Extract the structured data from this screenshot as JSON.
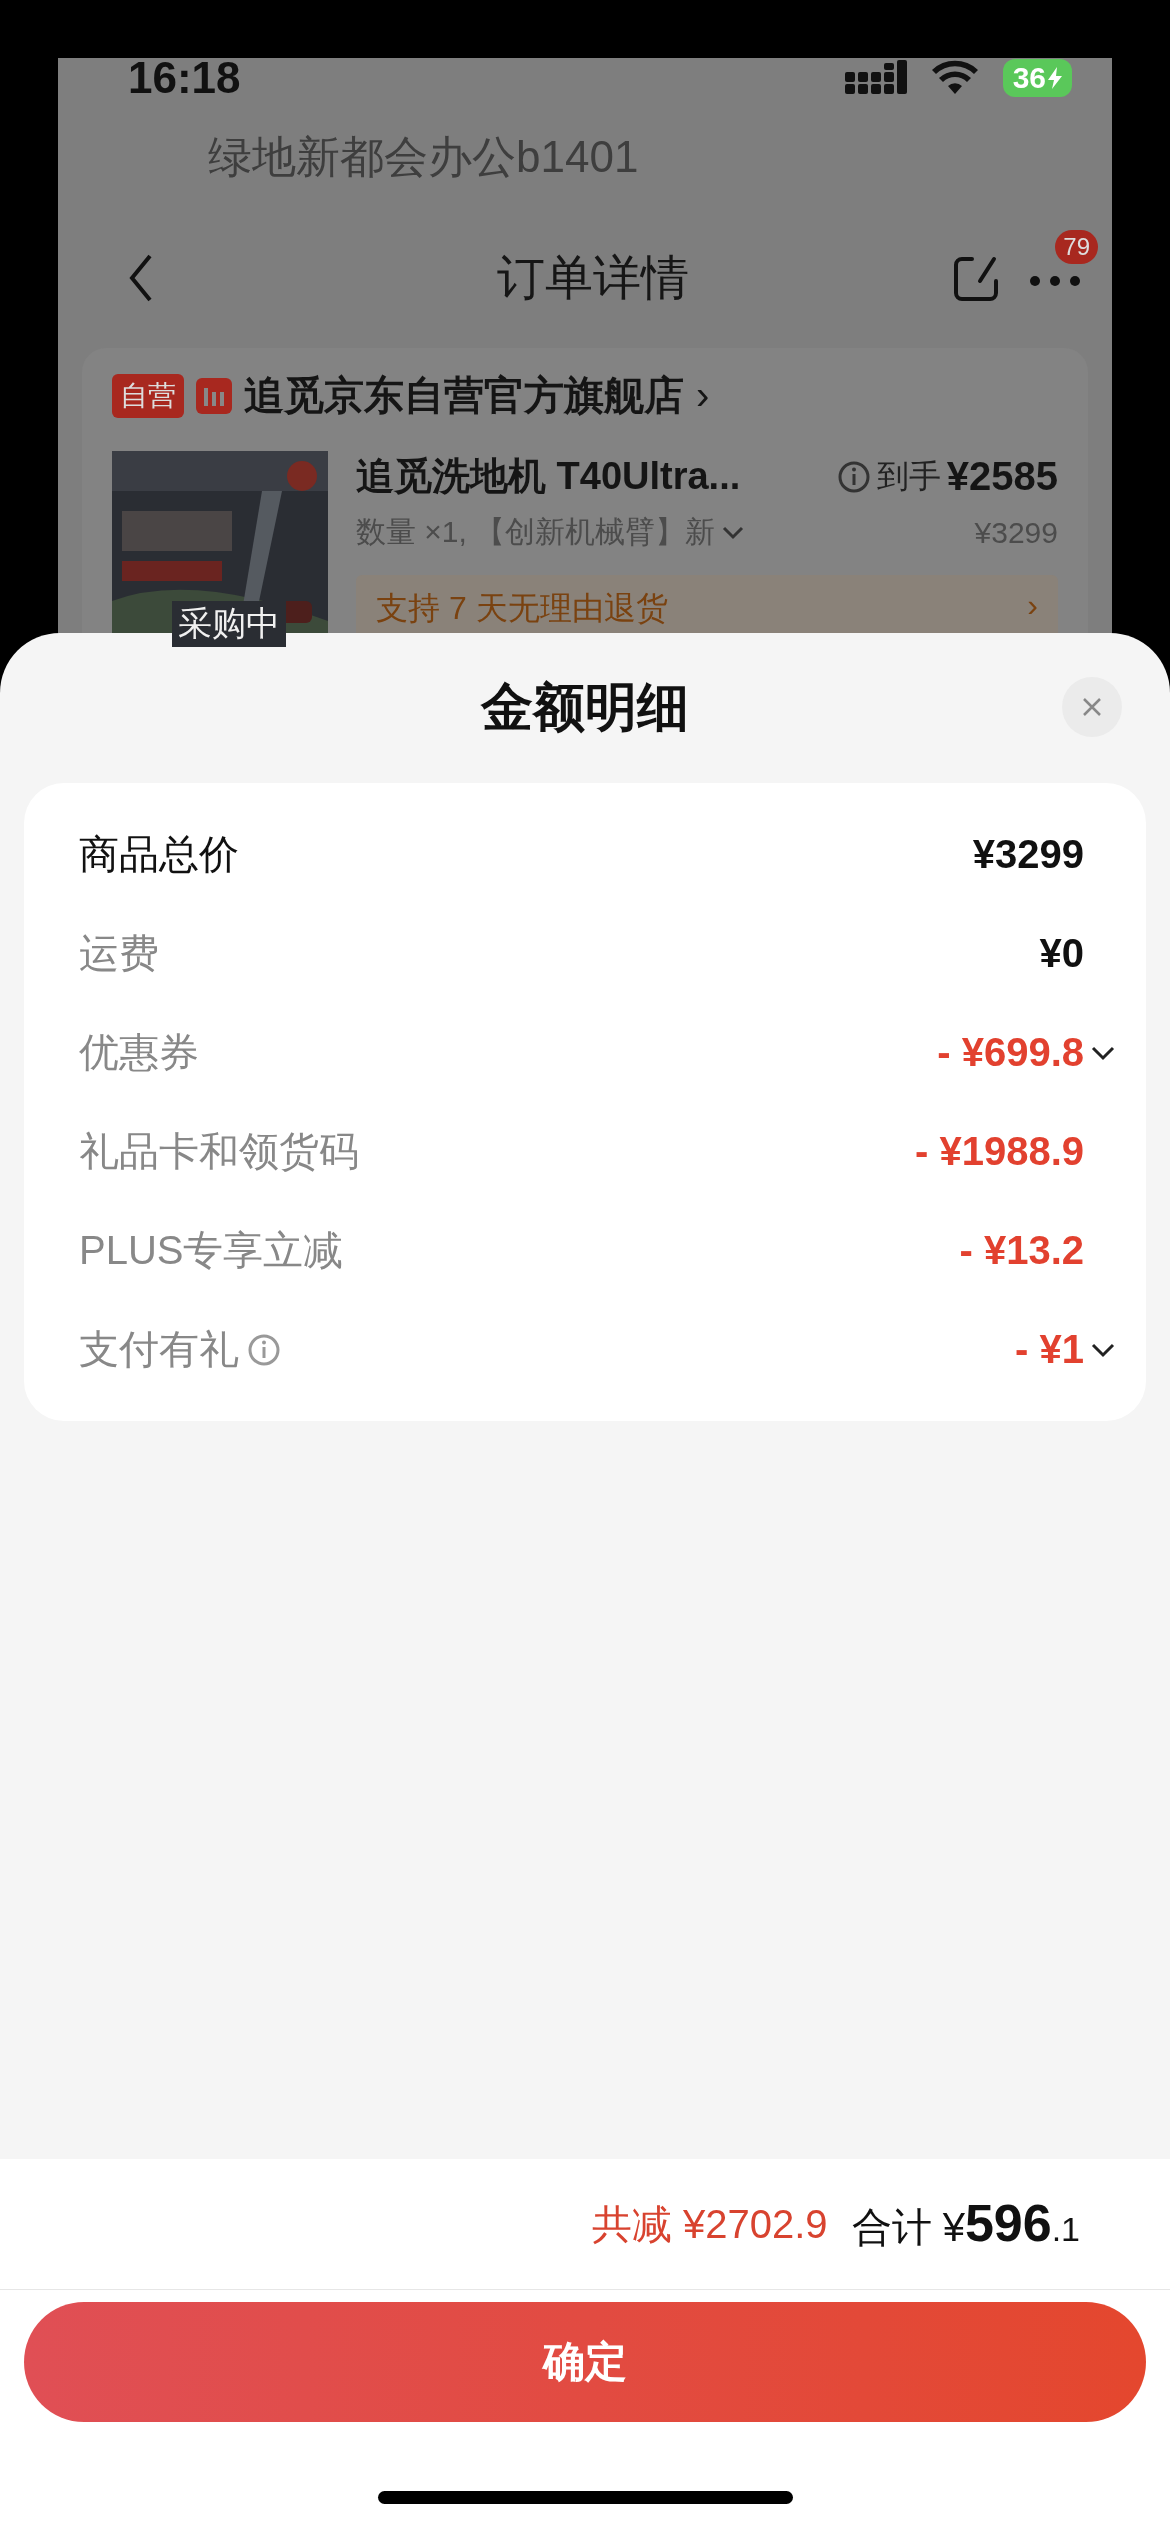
{
  "status_bar": {
    "time": "16:18",
    "battery": "36"
  },
  "background_page": {
    "address": "绿地新都会办公b1401",
    "title": "订单详情",
    "badge": "79",
    "store": {
      "tag": "自营",
      "name": "追觅京东自营官方旗舰店",
      "arrow": "›"
    },
    "product": {
      "title": "追觅洗地机 T40Ultra...",
      "price_label": "到手",
      "price": "¥2585",
      "spec": "数量 ×1, 【创新机械臂】新",
      "original_price": "¥3299",
      "status": "采购中"
    },
    "return_banner": {
      "text": "支持 7 天无理由退货",
      "arrow": "›"
    }
  },
  "sheet": {
    "title": "金额明细",
    "rows": [
      {
        "label": "商品总价",
        "value": "¥3299",
        "kind": "total",
        "expandable": false,
        "info": false
      },
      {
        "label": "运费",
        "value": "¥0",
        "kind": "plain",
        "expandable": false,
        "info": false
      },
      {
        "label": "优惠券",
        "value": "- ¥699.8",
        "kind": "discount",
        "expandable": true,
        "info": false
      },
      {
        "label": "礼品卡和领货码",
        "value": "- ¥1988.9",
        "kind": "discount",
        "expandable": false,
        "info": false
      },
      {
        "label": "PLUS专享立减",
        "value": "- ¥13.2",
        "kind": "discount",
        "expandable": false,
        "info": false
      },
      {
        "label": "支付有礼",
        "value": "- ¥1",
        "kind": "discount",
        "expandable": true,
        "info": true
      }
    ],
    "saving": {
      "label": "共减",
      "value": "¥2702.9"
    },
    "total": {
      "label": "合计",
      "currency": "¥",
      "integer": "596",
      "decimal": ".1"
    },
    "confirm_button": "确定"
  }
}
